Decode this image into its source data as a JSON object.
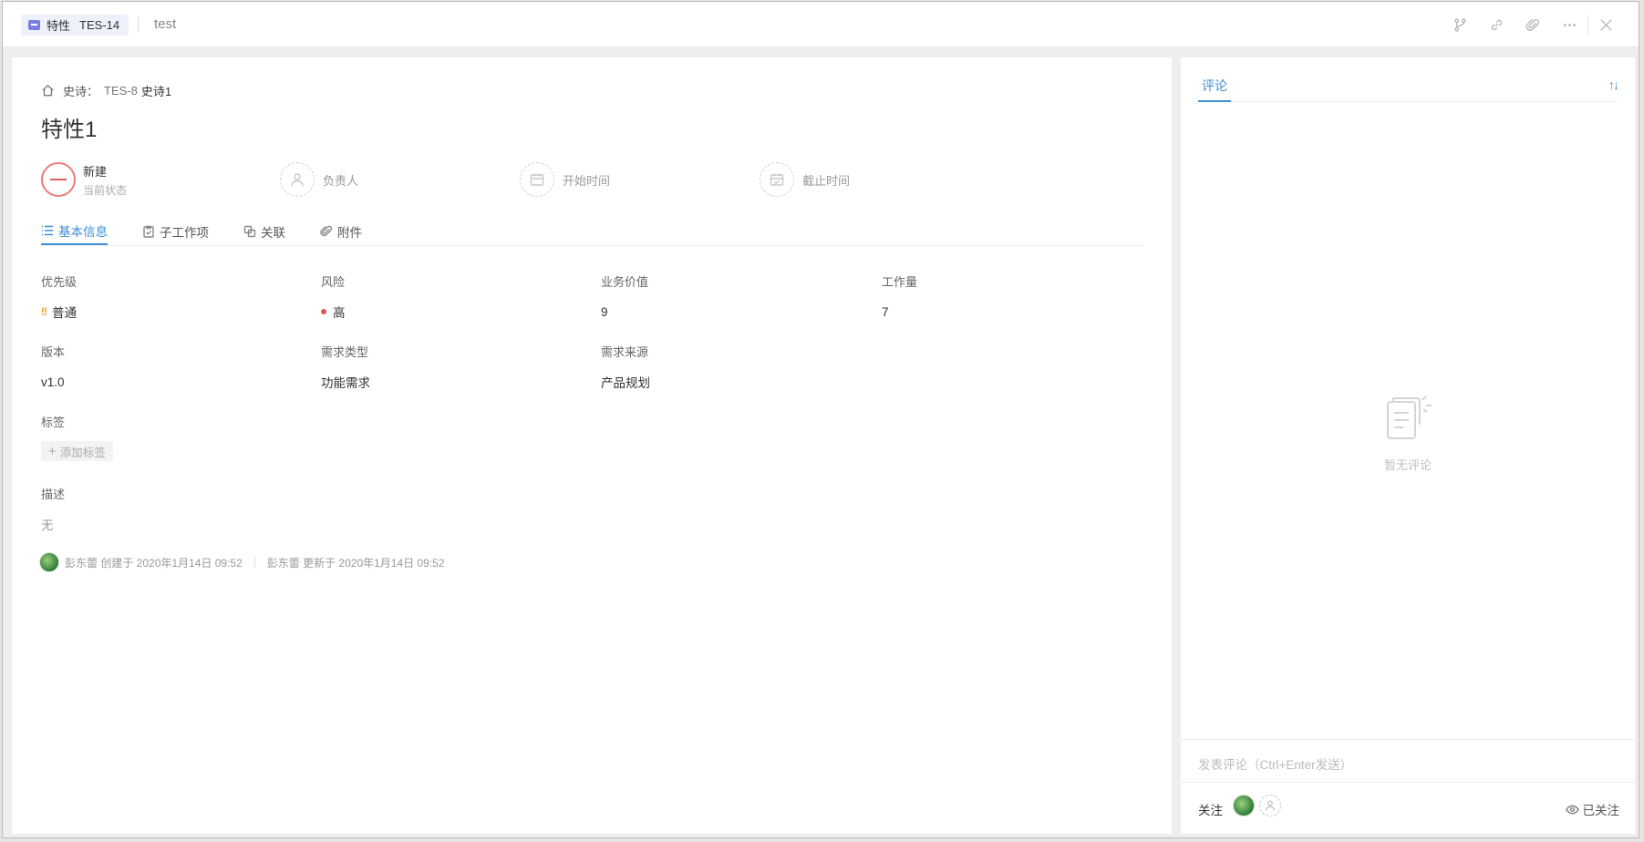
{
  "header": {
    "type_label": "特性",
    "code": "TES-14",
    "project": "test",
    "tools": [
      "branch-icon",
      "link-icon",
      "attachment-icon",
      "more-icon",
      "close-icon"
    ]
  },
  "breadcrumb": {
    "prefix": "史诗：",
    "code": "TES-8",
    "name": "史诗1"
  },
  "title": "特性1",
  "meta": {
    "state": "新建",
    "state_caption": "当前状态",
    "assignee": "负责人",
    "start": "开始时间",
    "due": "截止时间",
    "state_color": "#e35b5b"
  },
  "tabs": [
    {
      "label": "基本信息",
      "icon": "list-icon",
      "active": true
    },
    {
      "label": "子工作项",
      "icon": "clipboard-icon",
      "active": false
    },
    {
      "label": "关联",
      "icon": "relation-icon",
      "active": false
    },
    {
      "label": "附件",
      "icon": "paperclip-icon",
      "active": false
    }
  ],
  "fields": {
    "priority": {
      "label": "优先级",
      "value": "普通"
    },
    "risk": {
      "label": "风险",
      "value": "高"
    },
    "business_value": {
      "label": "业务价值",
      "value": "9"
    },
    "workload": {
      "label": "工作量",
      "value": "7"
    },
    "version": {
      "label": "版本",
      "value": "v1.0"
    },
    "req_type": {
      "label": "需求类型",
      "value": "功能需求"
    },
    "req_source": {
      "label": "需求来源",
      "value": "产品规划"
    },
    "tags": {
      "label": "标签",
      "add": "添加标签"
    },
    "description": {
      "label": "描述",
      "value": "无"
    }
  },
  "footer": {
    "created": "彭东蕾 创建于 2020年1月14日 09:52",
    "updated": "彭东蕾 更新于 2020年1月14日 09:52"
  },
  "comments": {
    "tab": "评论",
    "empty": "暂无评论",
    "placeholder": "发表评论（Ctrl+Enter发送）",
    "follow_label": "关注",
    "watching": "已关注"
  },
  "colors": {
    "accent": "#3e8ed6",
    "priority": "#f0a020",
    "risk_high": "#e55353"
  }
}
